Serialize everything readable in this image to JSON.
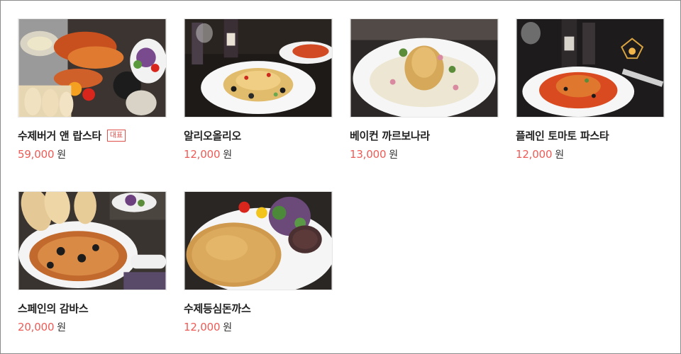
{
  "menu": {
    "currency_unit": "원",
    "items": [
      {
        "name": "수제버거 앤 랍스타",
        "badge": "대표",
        "price": "59,000",
        "image_icon": "lobster-platter-photo"
      },
      {
        "name": "알리오올리오",
        "price": "12,000",
        "image_icon": "aglio-olio-photo"
      },
      {
        "name": "베이컨 까르보나라",
        "price": "13,000",
        "image_icon": "carbonara-photo"
      },
      {
        "name": "플레인 토마토 파스타",
        "price": "12,000",
        "image_icon": "tomato-pasta-photo"
      },
      {
        "name": "스페인의 감바스",
        "price": "20,000",
        "image_icon": "gambas-photo"
      },
      {
        "name": "수제등심돈까스",
        "price": "12,000",
        "image_icon": "pork-cutlet-photo"
      }
    ]
  },
  "colors": {
    "price": "#ef5b56",
    "badge": "#e0504b",
    "name": "#222222"
  }
}
